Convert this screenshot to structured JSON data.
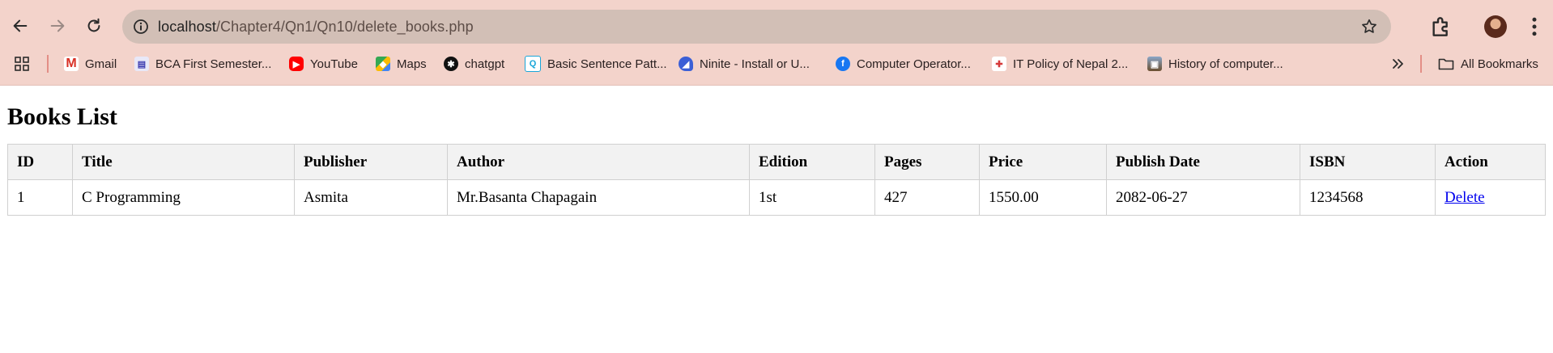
{
  "browser": {
    "url_host": "localhost",
    "url_path": "/Chapter4/Qn1/Qn10/delete_books.php",
    "bookmarks": [
      {
        "label": "Gmail",
        "icon": "gmail-icon"
      },
      {
        "label": "BCA First Semester...",
        "icon": "bca-icon"
      },
      {
        "label": "YouTube",
        "icon": "youtube-icon"
      },
      {
        "label": "Maps",
        "icon": "maps-icon"
      },
      {
        "label": "chatgpt",
        "icon": "chatgpt-icon"
      },
      {
        "label": "Basic Sentence Patt...",
        "icon": "quizlet-icon"
      },
      {
        "label": "Ninite - Install or U...",
        "icon": "ninite-icon"
      },
      {
        "label": "Computer Operator...",
        "icon": "facebook-icon"
      },
      {
        "label": "IT Policy of Nepal 2...",
        "icon": "policy-icon"
      },
      {
        "label": "History of computer...",
        "icon": "history-icon"
      }
    ],
    "all_bookmarks_label": "All Bookmarks",
    "accent_color": "#f3d3cb"
  },
  "page": {
    "title": "Books List",
    "table": {
      "headers": [
        "ID",
        "Title",
        "Publisher",
        "Author",
        "Edition",
        "Pages",
        "Price",
        "Publish Date",
        "ISBN",
        "Action"
      ],
      "rows": [
        {
          "id": "1",
          "title": "C Programming",
          "publisher": "Asmita",
          "author": "Mr.Basanta Chapagain",
          "edition": "1st",
          "pages": "427",
          "price": "1550.00",
          "publish_date": "2082-06-27",
          "isbn": "1234568",
          "action": "Delete"
        }
      ]
    }
  }
}
